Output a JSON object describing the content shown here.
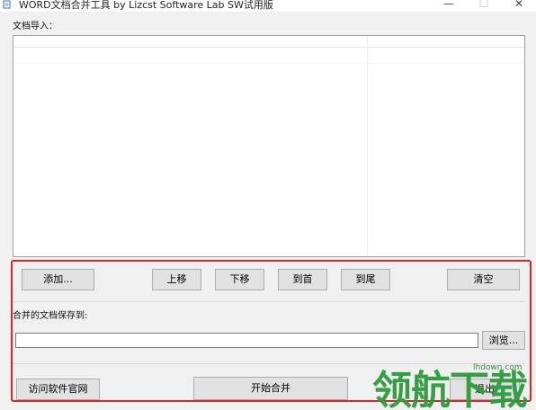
{
  "window": {
    "title": "WORD文档合并工具   by Lizcst Software Lab  SW试用版",
    "minimize_glyph": "—",
    "maximize_glyph": "☐",
    "close_glyph": "✕"
  },
  "import_section": {
    "label": "文档导入："
  },
  "toolbar": {
    "add_label": "添加...",
    "move_up_label": "上移",
    "move_down_label": "下移",
    "to_top_label": "到首",
    "to_bottom_label": "到尾",
    "clear_label": "清空"
  },
  "save_section": {
    "label": "合并的文档保存到:",
    "path_value": "",
    "browse_label": "浏览..."
  },
  "footer": {
    "visit_site_label": "访问软件官网",
    "start_merge_label": "开始合并",
    "exit_label": "退出"
  },
  "watermark": {
    "brand_text": "领航下载",
    "site_text": "lhdown.com"
  },
  "colors": {
    "highlight": "#d9262b",
    "watermark": "#2e9a3e"
  }
}
